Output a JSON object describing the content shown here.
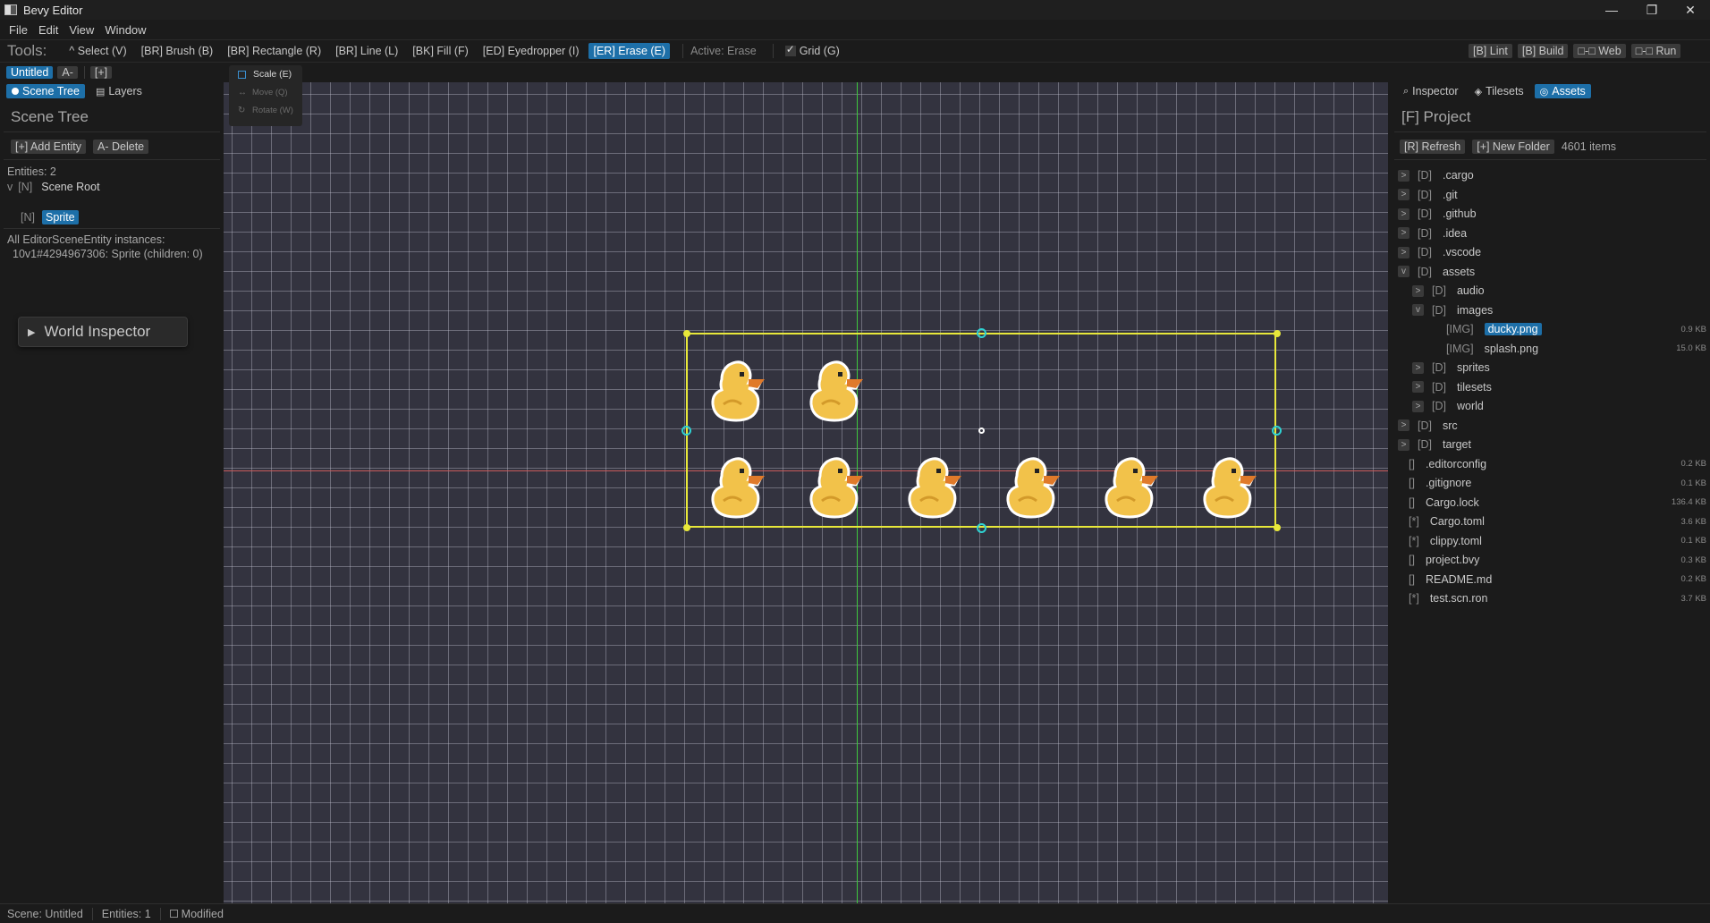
{
  "window": {
    "title": "Bevy Editor"
  },
  "menu": [
    "File",
    "Edit",
    "View",
    "Window"
  ],
  "toolbar": {
    "tools_label": "Tools:",
    "tools": [
      {
        "label": "^ Select (V)",
        "active": false
      },
      {
        "label": "[BR] Brush (B)",
        "active": false
      },
      {
        "label": "[BR] Rectangle (R)",
        "active": false
      },
      {
        "label": "[BR] Line (L)",
        "active": false
      },
      {
        "label": "[BK] Fill (F)",
        "active": false
      },
      {
        "label": "[ED] Eyedropper (I)",
        "active": false
      },
      {
        "label": "[ER] Erase (E)",
        "active": true
      }
    ],
    "active_text": "Active: Erase",
    "grid_label": "Grid (G)",
    "grid_checked": true,
    "right_buttons": [
      "[B] Lint",
      "[B] Build",
      "□-□ Web",
      "□-□ Run"
    ]
  },
  "scene_tabs": {
    "active": "Untitled",
    "close": "A-",
    "add": "[+]"
  },
  "left_panel": {
    "tabs": [
      "Scene Tree",
      "Layers"
    ],
    "heading": "Scene Tree",
    "add_entity": "[+] Add Entity",
    "delete": "A- Delete",
    "entities_count": "Entities: 2",
    "root_toggle": "v",
    "root_kind": "[N]",
    "root_label": "Scene Root",
    "child_kind": "[N]",
    "child_label": "Sprite",
    "instances_title": "All EditorSceneEntity instances:",
    "instance_line": "10v1#4294967306: Sprite (children: 0)",
    "world_inspector": "World Inspector"
  },
  "gizmo": {
    "scale": "Scale (E)",
    "move": "Move (Q)",
    "rotate": "Rotate (W)"
  },
  "right_panel": {
    "tabs": [
      "Inspector",
      "Tilesets",
      "Assets"
    ],
    "active_tab": "Assets",
    "heading": "[F] Project",
    "refresh": "[R] Refresh",
    "new_folder": "[+] New Folder",
    "item_count": "4601 items",
    "tree": [
      {
        "exp": ">",
        "kind": "[D]",
        "name": ".cargo",
        "indent": 0,
        "size": ""
      },
      {
        "exp": ">",
        "kind": "[D]",
        "name": ".git",
        "indent": 0,
        "size": ""
      },
      {
        "exp": ">",
        "kind": "[D]",
        "name": ".github",
        "indent": 0,
        "size": ""
      },
      {
        "exp": ">",
        "kind": "[D]",
        "name": ".idea",
        "indent": 0,
        "size": ""
      },
      {
        "exp": ">",
        "kind": "[D]",
        "name": ".vscode",
        "indent": 0,
        "size": ""
      },
      {
        "exp": "v",
        "kind": "[D]",
        "name": "assets",
        "indent": 0,
        "size": ""
      },
      {
        "exp": ">",
        "kind": "[D]",
        "name": "audio",
        "indent": 1,
        "size": ""
      },
      {
        "exp": "v",
        "kind": "[D]",
        "name": "images",
        "indent": 1,
        "size": ""
      },
      {
        "exp": "",
        "kind": "[IMG]",
        "name": "ducky.png",
        "indent": 2,
        "size": "0.9 KB",
        "selected": true
      },
      {
        "exp": "",
        "kind": "[IMG]",
        "name": "splash.png",
        "indent": 2,
        "size": "15.0 KB"
      },
      {
        "exp": ">",
        "kind": "[D]",
        "name": "sprites",
        "indent": 1,
        "size": ""
      },
      {
        "exp": ">",
        "kind": "[D]",
        "name": "tilesets",
        "indent": 1,
        "size": ""
      },
      {
        "exp": ">",
        "kind": "[D]",
        "name": "world",
        "indent": 1,
        "size": ""
      },
      {
        "exp": ">",
        "kind": "[D]",
        "name": "src",
        "indent": 0,
        "size": ""
      },
      {
        "exp": ">",
        "kind": "[D]",
        "name": "target",
        "indent": 0,
        "size": ""
      },
      {
        "exp": "",
        "kind": "[]",
        "name": ".editorconfig",
        "indent": 0,
        "size": "0.2 KB"
      },
      {
        "exp": "",
        "kind": "[]",
        "name": ".gitignore",
        "indent": 0,
        "size": "0.1 KB"
      },
      {
        "exp": "",
        "kind": "[]",
        "name": "Cargo.lock",
        "indent": 0,
        "size": "136.4 KB"
      },
      {
        "exp": "",
        "kind": "[*]",
        "name": "Cargo.toml",
        "indent": 0,
        "size": "3.6 KB"
      },
      {
        "exp": "",
        "kind": "[*]",
        "name": "clippy.toml",
        "indent": 0,
        "size": "0.1 KB"
      },
      {
        "exp": "",
        "kind": "[]",
        "name": "project.bvy",
        "indent": 0,
        "size": "0.3 KB"
      },
      {
        "exp": "",
        "kind": "[]",
        "name": "README.md",
        "indent": 0,
        "size": "0.2 KB"
      },
      {
        "exp": "",
        "kind": "[*]",
        "name": "test.scn.ron",
        "indent": 0,
        "size": "3.7 KB"
      }
    ]
  },
  "status": {
    "scene": "Scene: Untitled",
    "entities": "Entities: 1",
    "modified": "Modified"
  },
  "colors": {
    "accent": "#1d6fa8",
    "selection": "#e8e83a",
    "handle": "#2ed3d3",
    "axis_y": "#3ec83e",
    "axis_x": "#c85a5a",
    "duck_body": "#f2c24a"
  }
}
